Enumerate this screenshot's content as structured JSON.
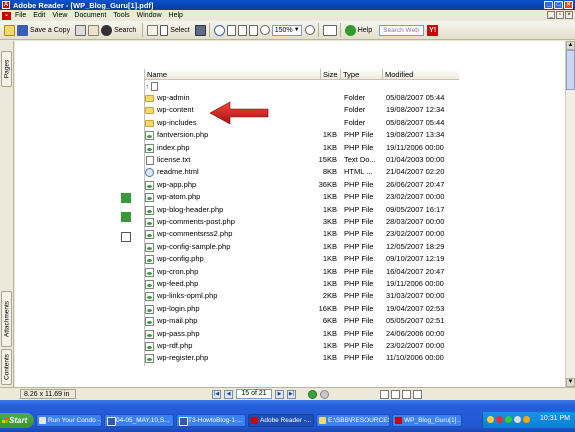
{
  "window": {
    "title": "Adobe Reader - [WP_Blog_Guru[1].pdf]",
    "app_icon": "adobe-reader-icon"
  },
  "menu": [
    "File",
    "Edit",
    "View",
    "Document",
    "Tools",
    "Window",
    "Help"
  ],
  "toolbar": {
    "save_copy": "Save a Copy",
    "search": "Search",
    "select": "Select",
    "zoom": "150%",
    "help": "Help",
    "search_web_placeholder": "Search Web"
  },
  "nav_tabs": {
    "pages": "Pages",
    "attachments": "Attachments",
    "contents": "Contents"
  },
  "explorer": {
    "columns": [
      "Name",
      "Size",
      "Type",
      "Modified"
    ],
    "rows": [
      {
        "name": "wp-admin",
        "size": "",
        "type": "Folder",
        "modified": "05/08/2007 05:44",
        "icon": "folder"
      },
      {
        "name": "wp-content",
        "size": "",
        "type": "Folder",
        "modified": "19/08/2007 12:34",
        "icon": "folder"
      },
      {
        "name": "wp-includes",
        "size": "",
        "type": "Folder",
        "modified": "05/08/2007 05:44",
        "icon": "folder"
      },
      {
        "name": "fantversion.php",
        "size": "1KB",
        "type": "PHP File",
        "modified": "19/08/2007 13:34",
        "icon": "php"
      },
      {
        "name": "index.php",
        "size": "1KB",
        "type": "PHP File",
        "modified": "19/11/2006 00:00",
        "icon": "php"
      },
      {
        "name": "license.txt",
        "size": "15KB",
        "type": "Text Do...",
        "modified": "01/04/2003 00:00",
        "icon": "txt"
      },
      {
        "name": "readme.html",
        "size": "8KB",
        "type": "HTML ...",
        "modified": "21/04/2007 02:20",
        "icon": "html"
      },
      {
        "name": "wp-app.php",
        "size": "36KB",
        "type": "PHP File",
        "modified": "26/06/2007 20:47",
        "icon": "php"
      },
      {
        "name": "wp-atom.php",
        "size": "1KB",
        "type": "PHP File",
        "modified": "23/02/2007 00:00",
        "icon": "php"
      },
      {
        "name": "wp-blog-header.php",
        "size": "1KB",
        "type": "PHP File",
        "modified": "09/05/2007 16:17",
        "icon": "php"
      },
      {
        "name": "wp-comments-post.php",
        "size": "3KB",
        "type": "PHP File",
        "modified": "28/03/2007 00:00",
        "icon": "php"
      },
      {
        "name": "wp-commentsrss2.php",
        "size": "1KB",
        "type": "PHP File",
        "modified": "23/02/2007 00:00",
        "icon": "php"
      },
      {
        "name": "wp-config-sample.php",
        "size": "1KB",
        "type": "PHP File",
        "modified": "12/05/2007 18:29",
        "icon": "php"
      },
      {
        "name": "wp-config.php",
        "size": "1KB",
        "type": "PHP File",
        "modified": "09/10/2007 12:19",
        "icon": "php"
      },
      {
        "name": "wp-cron.php",
        "size": "1KB",
        "type": "PHP File",
        "modified": "16/04/2007 20:47",
        "icon": "php"
      },
      {
        "name": "wp-feed.php",
        "size": "1KB",
        "type": "PHP File",
        "modified": "19/11/2006 00:00",
        "icon": "php"
      },
      {
        "name": "wp-links-opml.php",
        "size": "2KB",
        "type": "PHP File",
        "modified": "31/03/2007 00:00",
        "icon": "php"
      },
      {
        "name": "wp-login.php",
        "size": "16KB",
        "type": "PHP File",
        "modified": "19/04/2007 02:53",
        "icon": "php"
      },
      {
        "name": "wp-mail.php",
        "size": "6KB",
        "type": "PHP File",
        "modified": "05/05/2007 02:51",
        "icon": "php"
      },
      {
        "name": "wp-pass.php",
        "size": "1KB",
        "type": "PHP File",
        "modified": "24/06/2006 00:00",
        "icon": "php"
      },
      {
        "name": "wp-rdf.php",
        "size": "1KB",
        "type": "PHP File",
        "modified": "23/02/2007 00:00",
        "icon": "php"
      },
      {
        "name": "wp-register.php",
        "size": "1KB",
        "type": "PHP File",
        "modified": "11/10/2006 00:00",
        "icon": "php"
      }
    ]
  },
  "status": {
    "page_size": "8.26 x 11.69 in",
    "page_indicator": "15 of 21"
  },
  "taskbar": {
    "start": "Start",
    "tasks": [
      "Run Your Condo -...",
      "04-05_MAY,10,S...",
      "T3-HowtoBlog-1-...",
      "Adobe Reader -...",
      "E:\\SBB\\RESOURCES",
      "WP_Blog_Guru[1]..."
    ],
    "clock": "10:31 PM"
  },
  "colors": {
    "titlebar": "#0a53c9",
    "taskbar": "#245ddb",
    "arrow": "#d01818",
    "folder": "#f5d86a"
  }
}
